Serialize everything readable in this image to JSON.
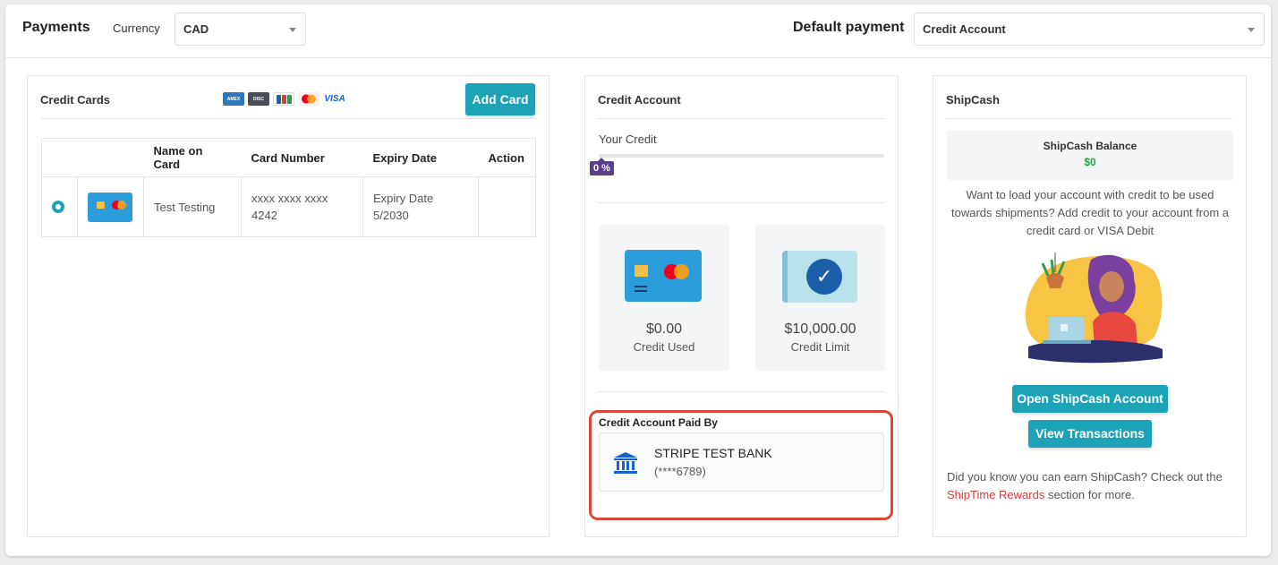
{
  "header": {
    "title": "Payments",
    "currency_label": "Currency",
    "currency_value": "CAD",
    "default_payment_label": "Default payment",
    "default_payment_value": "Credit Account"
  },
  "credit_cards": {
    "title": "Credit Cards",
    "card_brands": [
      "amex-logo",
      "discover-logo",
      "jcb-logo",
      "mastercard-logo",
      "visa-logo"
    ],
    "brand_visa_text": "VISA",
    "add_button": "Add Card",
    "columns": [
      "",
      "",
      "Name on Card",
      "Card Number",
      "Expiry Date",
      "Action"
    ],
    "rows": [
      {
        "name": "Test Testing",
        "number_line1": "xxxx xxxx xxxx",
        "number_line2": "4242",
        "expiry_line1": "Expiry Date",
        "expiry_line2": "5/2030",
        "action": ""
      }
    ]
  },
  "credit_account": {
    "title": "Credit Account",
    "your_credit_label": "Your Credit",
    "progress_percent": 0,
    "progress_text": "0 %",
    "credit_used_value": "$0.00",
    "credit_used_label": "Credit Used",
    "credit_limit_value": "$10,000.00",
    "credit_limit_label": "Credit Limit",
    "paid_by_title": "Credit Account Paid By",
    "bank_name": "STRIPE TEST BANK",
    "bank_account": "(****6789)"
  },
  "shipcash": {
    "title": "ShipCash",
    "balance_title": "ShipCash Balance",
    "balance_value": "$0",
    "description": "Want to load your account with credit to be used towards shipments? Add credit to your account from a credit card or VISA Debit",
    "open_button": "Open ShipCash Account",
    "view_button": "View Transactions",
    "know_text": "Did you know you can earn ShipCash? Check out the",
    "rewards_link": "ShipTime Rewards",
    "know_suffix": "section for more."
  },
  "colors": {
    "accent": "#1ea2b8",
    "progress": "#5b3f8a",
    "positive": "#24a148",
    "highlight": "#d9473a",
    "link": "#d93a3a"
  }
}
